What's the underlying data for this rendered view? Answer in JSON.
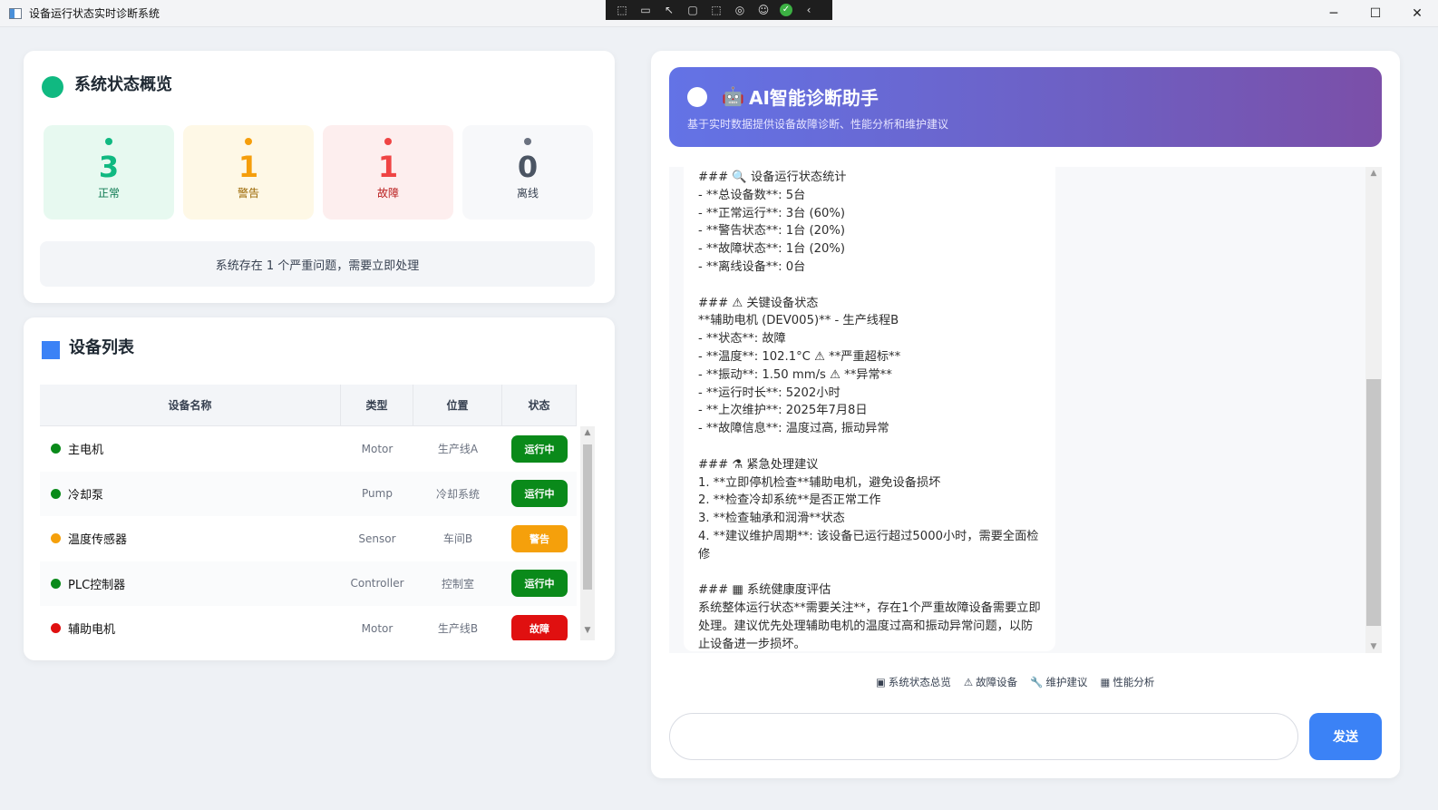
{
  "window": {
    "title": "设备运行状态实时诊断系统",
    "controls": {
      "minimize": "─",
      "maximize": "☐",
      "close": "✕"
    }
  },
  "overview": {
    "title": "系统状态概览",
    "stats": [
      {
        "value": "3",
        "label": "正常"
      },
      {
        "value": "1",
        "label": "警告"
      },
      {
        "value": "1",
        "label": "故障"
      },
      {
        "value": "0",
        "label": "离线"
      }
    ],
    "alert": "系统存在 1 个严重问题，需要立即处理"
  },
  "devices": {
    "title": "设备列表",
    "columns": [
      "设备名称",
      "类型",
      "位置",
      "状态"
    ],
    "rows": [
      {
        "name": "主电机",
        "type": "Motor",
        "location": "生产线A",
        "status": "运行中",
        "status_color": "#0a8a1a"
      },
      {
        "name": "冷却泵",
        "type": "Pump",
        "location": "冷却系统",
        "status": "运行中",
        "status_color": "#0a8a1a"
      },
      {
        "name": "温度传感器",
        "type": "Sensor",
        "location": "车间B",
        "status": "警告",
        "status_color": "#f5a00b"
      },
      {
        "name": "PLC控制器",
        "type": "Controller",
        "location": "控制室",
        "status": "运行中",
        "status_color": "#0a8a1a"
      },
      {
        "name": "辅助电机",
        "type": "Motor",
        "location": "生产线B",
        "status": "故障",
        "status_color": "#e01010"
      }
    ]
  },
  "assistant": {
    "title": "AI智能诊断助手",
    "subtitle": "基于实时数据提供设备故障诊断、性能分析和维护建议",
    "message": "### 🔍 设备运行状态统计\n- **总设备数**: 5台\n- **正常运行**: 3台 (60%)\n- **警告状态**: 1台 (20%)\n- **故障状态**: 1台 (20%)\n- **离线设备**: 0台\n\n### ⚠ 关键设备状态\n**辅助电机 (DEV005)** - 生产线程B\n- **状态**: 故障\n- **温度**: 102.1°C ⚠ **严重超标**\n- **振动**: 1.50 mm/s ⚠ **异常**\n- **运行时长**: 5202小时\n- **上次维护**: 2025年7月8日\n- **故障信息**: 温度过高, 振动异常\n\n### ⚗ 紧急处理建议\n1. **立即停机检查**辅助电机，避免设备损坏\n2. **检查冷却系统**是否正常工作\n3. **检查轴承和润滑**状态\n4. **建议维护周期**: 该设备已运行超过5000小时，需要全面检修\n\n### ▦ 系统健康度评估\n系统整体运行状态**需要关注**，存在1个严重故障设备需要立即处理。建议优先处理辅助电机的温度过高和振动异常问题，以防止设备进一步损坏。",
    "quick_actions": [
      {
        "icon": "▣",
        "label": "系统状态总览"
      },
      {
        "icon": "⚠",
        "label": "故障设备"
      },
      {
        "icon": "🔧",
        "label": "维护建议"
      },
      {
        "icon": "▦",
        "label": "性能分析"
      }
    ],
    "input_placeholder": "",
    "send_label": "发送"
  }
}
